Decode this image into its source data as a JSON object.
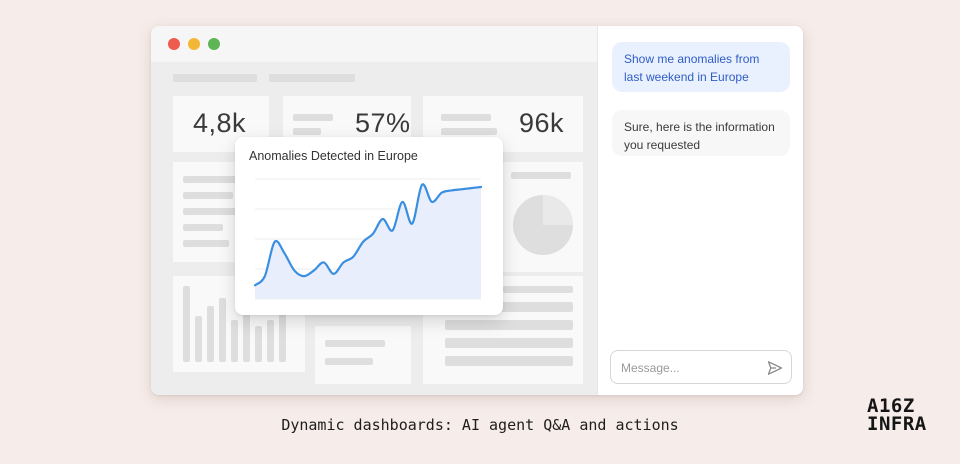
{
  "dashboard": {
    "stats": [
      {
        "value": "4,8k"
      },
      {
        "value": "57%"
      },
      {
        "value": "96k"
      }
    ],
    "chart_popup": {
      "title": "Anomalies Detected in Europe"
    }
  },
  "chat": {
    "messages": [
      {
        "role": "user",
        "text": "Show me anomalies from last weekend in Europe"
      },
      {
        "role": "agent",
        "text": "Sure, here is the information you requested"
      }
    ],
    "input": {
      "placeholder": "Message...",
      "value": ""
    }
  },
  "caption": "Dynamic dashboards: AI agent Q&A and actions",
  "logo": {
    "line1": "A16Z",
    "line2": "INFRA"
  },
  "colors": {
    "background": "#f6ece9",
    "line": "#3b8fe0",
    "area": "#e8eefc",
    "user_bubble": "#eaf1fe",
    "user_text": "#2e5cc7"
  },
  "chart_data": {
    "type": "area",
    "title": "Anomalies Detected in Europe",
    "xlabel": "",
    "ylabel": "",
    "grid": true,
    "x": [
      0,
      1,
      2,
      3,
      4,
      5,
      6,
      7,
      8,
      9,
      10,
      11,
      12,
      13,
      14,
      15,
      16,
      17,
      18,
      19,
      20,
      21,
      22,
      23
    ],
    "series": [
      {
        "values": [
          12,
          20,
          50,
          40,
          25,
          20,
          25,
          32,
          22,
          32,
          37,
          50,
          57,
          70,
          60,
          85,
          66,
          100,
          85,
          93,
          95,
          96,
          97,
          98
        ]
      }
    ]
  }
}
